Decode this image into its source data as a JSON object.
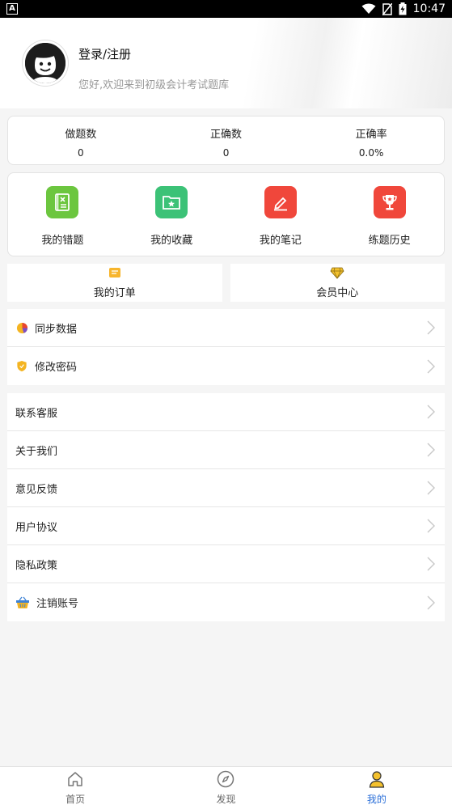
{
  "status_bar": {
    "time": "10:47"
  },
  "header": {
    "login_label": "登录/注册",
    "welcome_text": "您好,欢迎来到初级会计考试题库"
  },
  "stats": [
    {
      "label": "做题数",
      "value": "0"
    },
    {
      "label": "正确数",
      "value": "0"
    },
    {
      "label": "正确率",
      "value": "0.0%"
    }
  ],
  "features": [
    {
      "label": "我的错题",
      "color": "#6cc63f"
    },
    {
      "label": "我的收藏",
      "color": "#3cc277"
    },
    {
      "label": "我的笔记",
      "color": "#f0473b"
    },
    {
      "label": "练题历史",
      "color": "#f0473b"
    }
  ],
  "orders": [
    {
      "label": "我的订单"
    },
    {
      "label": "会员中心"
    }
  ],
  "group1": [
    {
      "label": "同步数据"
    },
    {
      "label": "修改密码"
    }
  ],
  "group2": [
    {
      "label": "联系客服"
    },
    {
      "label": "关于我们"
    },
    {
      "label": "意见反馈"
    },
    {
      "label": "用户协议"
    },
    {
      "label": "隐私政策"
    },
    {
      "label": "注销账号"
    }
  ],
  "tabs": [
    {
      "label": "首页"
    },
    {
      "label": "发现"
    },
    {
      "label": "我的"
    }
  ],
  "colors": {
    "accent": "#2b6fd8",
    "background": "#f5f5f5"
  }
}
